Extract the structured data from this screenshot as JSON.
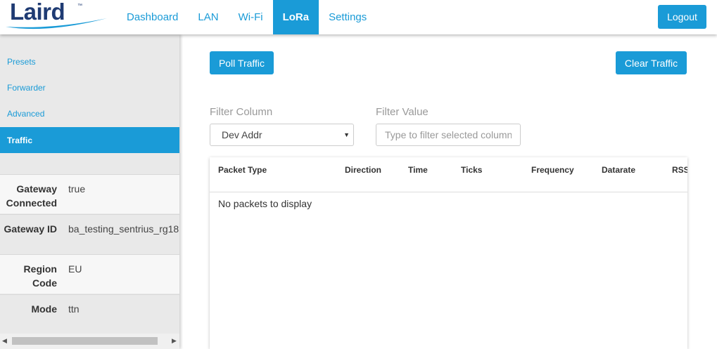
{
  "header": {
    "logo_text": "Laird",
    "logo_tm": "™",
    "tabs": [
      {
        "label": "Dashboard"
      },
      {
        "label": "LAN"
      },
      {
        "label": "Wi-Fi"
      },
      {
        "label": "LoRa"
      },
      {
        "label": "Settings"
      }
    ],
    "active_tab": "LoRa",
    "logout_label": "Logout"
  },
  "sidebar": {
    "items": [
      {
        "label": "Presets"
      },
      {
        "label": "Forwarder"
      },
      {
        "label": "Advanced"
      },
      {
        "label": "Traffic"
      }
    ],
    "active_item": "Traffic",
    "info": [
      {
        "key": "Gateway Connected",
        "value": "true"
      },
      {
        "key": "Gateway ID",
        "value": "ba_testing_sentrius_rg18"
      },
      {
        "key": "Region Code",
        "value": "EU"
      },
      {
        "key": "Mode",
        "value": "ttn"
      }
    ]
  },
  "main": {
    "poll_label": "Poll Traffic",
    "clear_label": "Clear Traffic",
    "filter_column_label": "Filter Column",
    "filter_column_value": "Dev Addr",
    "filter_value_label": "Filter Value",
    "filter_value_placeholder": "Type to filter selected column",
    "columns": [
      "Packet Type",
      "Direction",
      "Time",
      "Ticks",
      "Frequency",
      "Datarate",
      "RSSI"
    ],
    "empty_message": "No packets to display"
  },
  "colors": {
    "accent": "#1a9bd7",
    "brand": "#1f3b73",
    "sidebar_bg": "#e9e9e9"
  }
}
